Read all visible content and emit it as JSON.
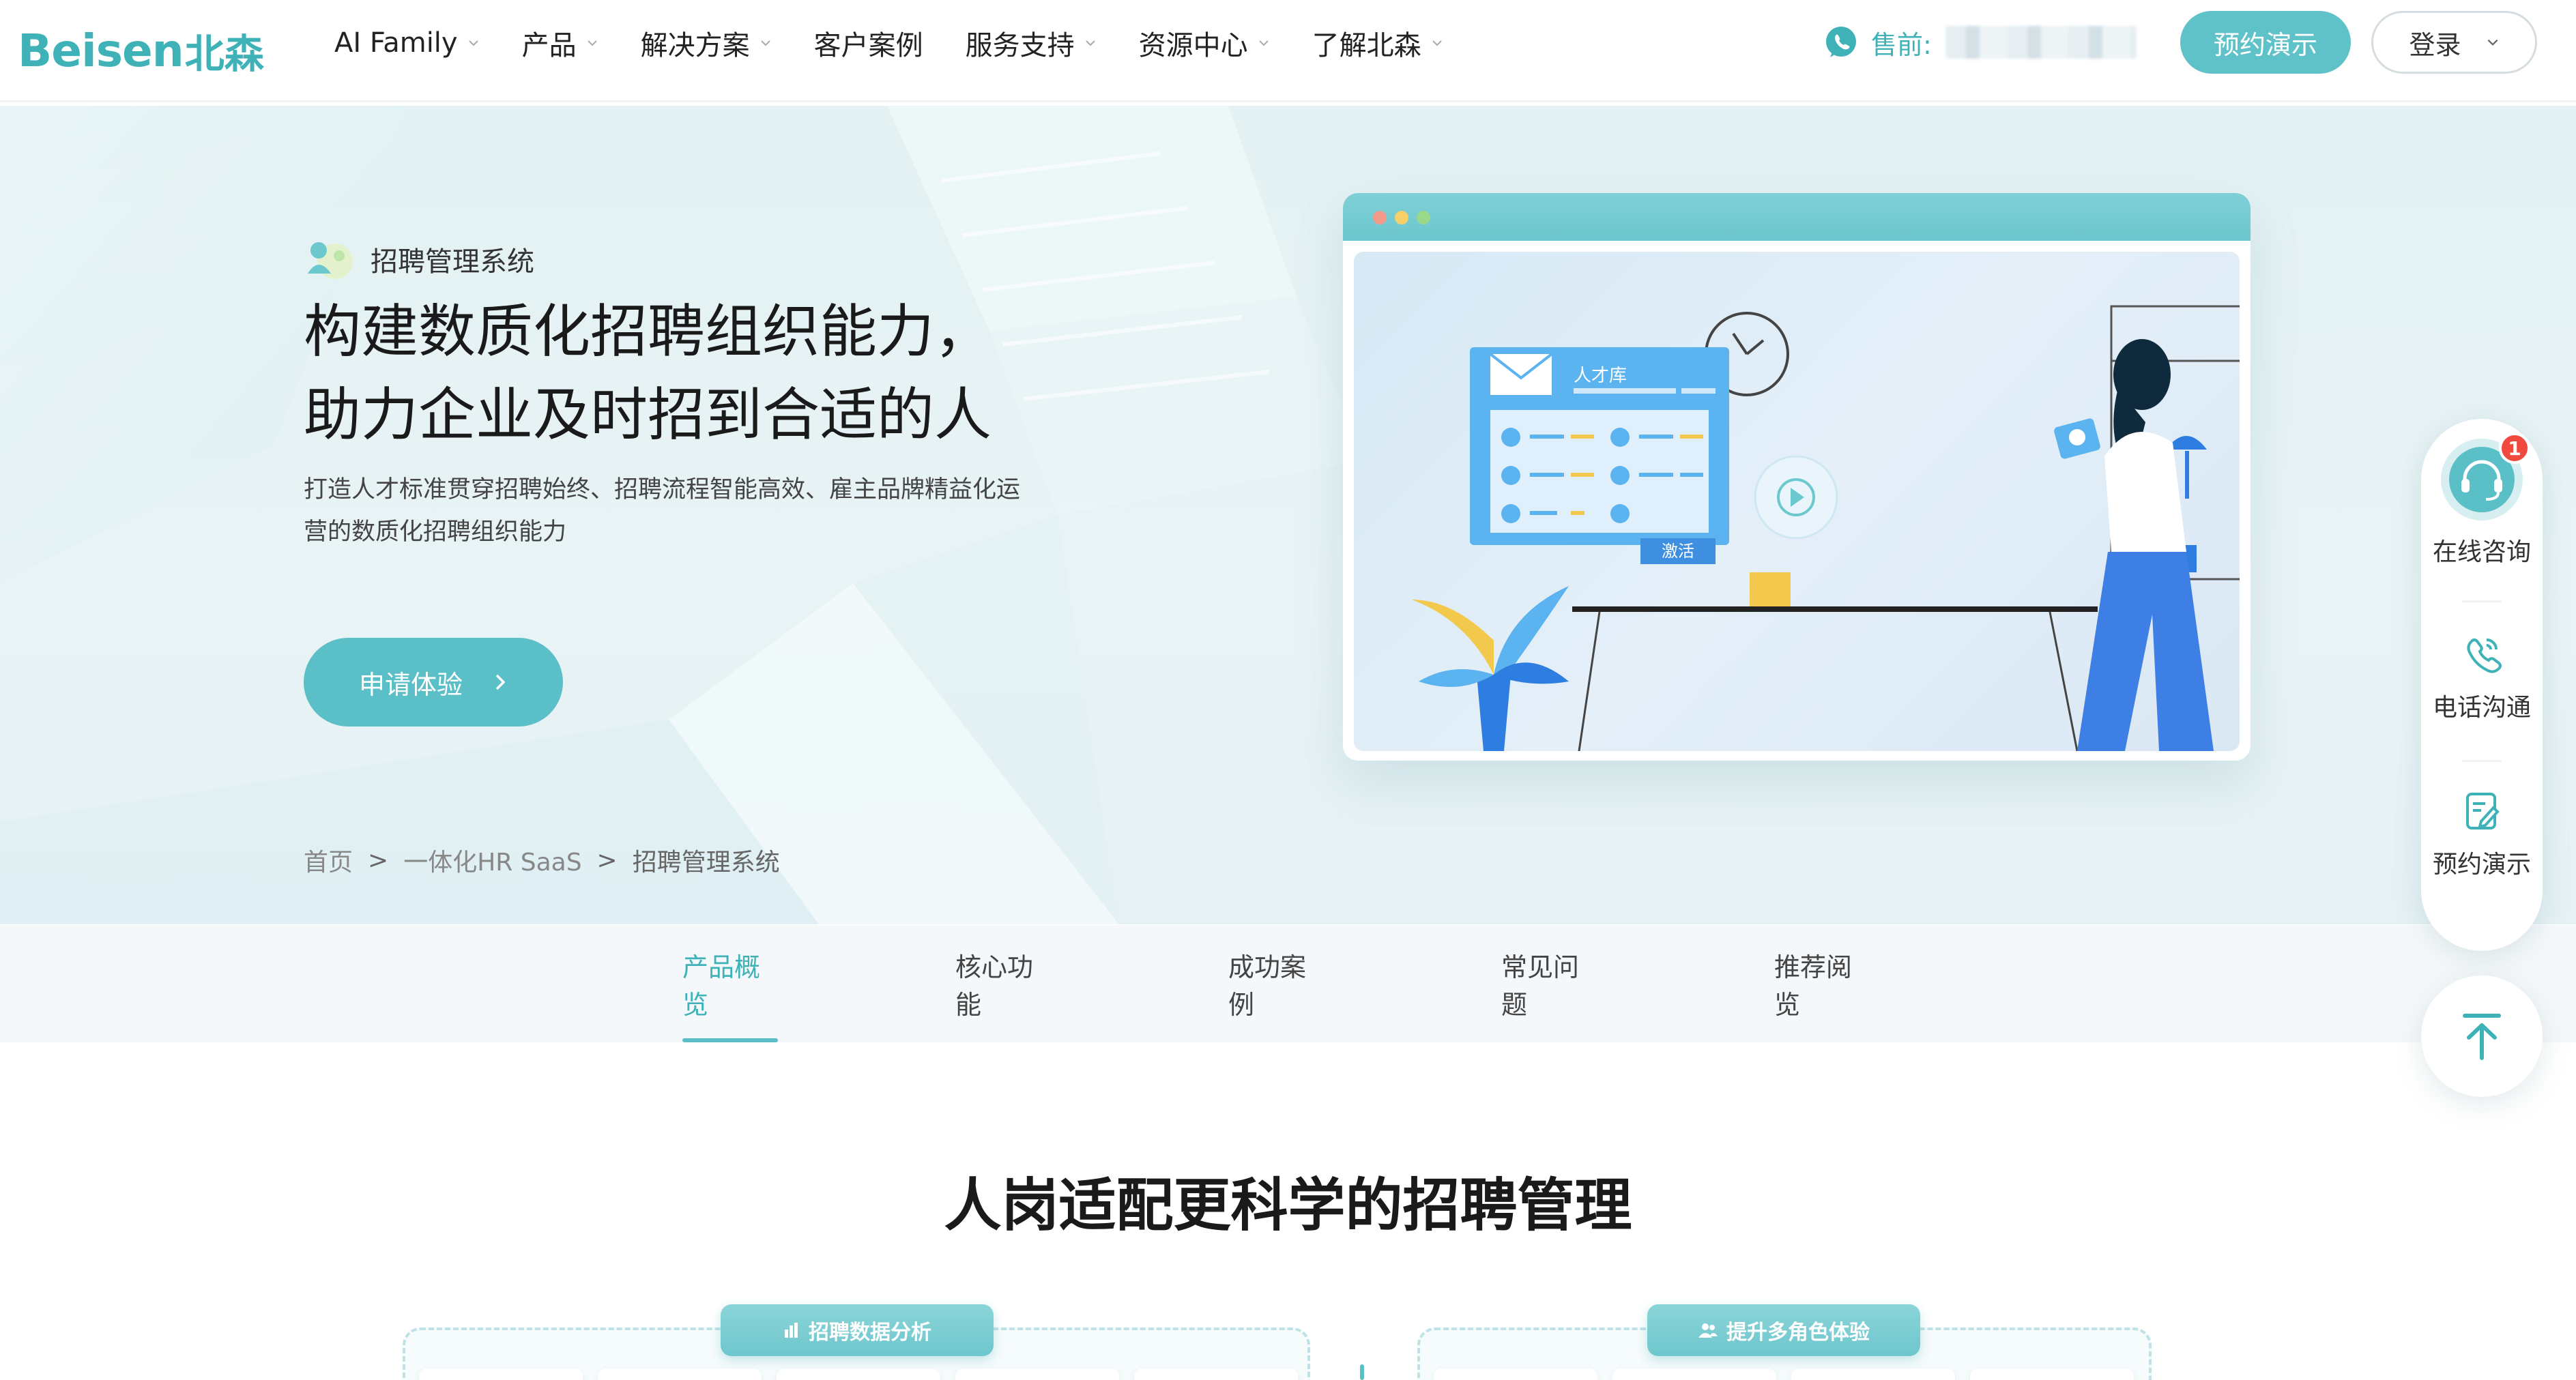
{
  "brand": {
    "logo_en": "Beisen",
    "logo_cn": "北森",
    "accent": "#3fb2b8",
    "accent_button": "#5fc2c8"
  },
  "nav": {
    "items": [
      {
        "label": "AI Family",
        "has_dropdown": true
      },
      {
        "label": "产品",
        "has_dropdown": true
      },
      {
        "label": "解决方案",
        "has_dropdown": true
      },
      {
        "label": "客户案例",
        "has_dropdown": false
      },
      {
        "label": "服务支持",
        "has_dropdown": true
      },
      {
        "label": "资源中心",
        "has_dropdown": true
      },
      {
        "label": "了解北森",
        "has_dropdown": true
      }
    ],
    "sales_label": "售前:",
    "demo_button": "预约演示",
    "login_button": "登录"
  },
  "hero": {
    "product_tag": "招聘管理系统",
    "title_line1": "构建数质化招聘组织能力，",
    "title_line2": "助力企业及时招到合适的人",
    "desc_line1": "打造人才标准贯穿招聘始终、招聘流程智能高效、雇主品牌精益化运",
    "desc_line2": "营的数质化招聘组织能力",
    "apply_button": "申请体验",
    "illustration": {
      "window_title": "人才库",
      "activate_button": "激活"
    }
  },
  "breadcrumb": {
    "items": [
      "首页",
      "一体化HR SaaS",
      "招聘管理系统"
    ],
    "separator": ">"
  },
  "tabs": {
    "items": [
      "产品概览",
      "核心功能",
      "成功案例",
      "常见问题",
      "推荐阅览"
    ],
    "active_index": 0
  },
  "section": {
    "title": "人岗适配更科学的招聘管理",
    "left_pill": "招聘数据分析",
    "right_pill": "提升多角色体验"
  },
  "float_sidebar": {
    "consult_label": "在线咨询",
    "consult_badge": "1",
    "phone_label": "电话沟通",
    "demo_label": "预约演示"
  }
}
